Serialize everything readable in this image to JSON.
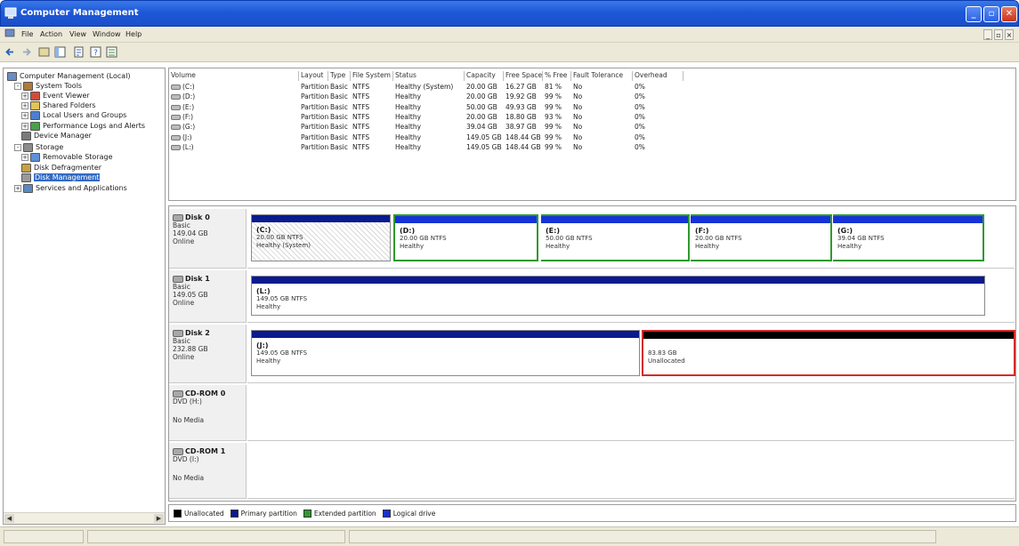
{
  "window": {
    "title": "Computer Management"
  },
  "menu": [
    "File",
    "Action",
    "View",
    "Window",
    "Help"
  ],
  "tree": [
    {
      "label": "Computer Management (Local)",
      "icon": "computer-icon",
      "indent": 0,
      "expander": ""
    },
    {
      "label": "System Tools",
      "icon": "tools-icon",
      "indent": 1,
      "expander": "-"
    },
    {
      "label": "Event Viewer",
      "icon": "event-viewer-icon",
      "indent": 2,
      "expander": "+"
    },
    {
      "label": "Shared Folders",
      "icon": "shared-folder-icon",
      "indent": 2,
      "expander": "+"
    },
    {
      "label": "Local Users and Groups",
      "icon": "users-icon",
      "indent": 2,
      "expander": "+"
    },
    {
      "label": "Performance Logs and Alerts",
      "icon": "performance-icon",
      "indent": 2,
      "expander": "+"
    },
    {
      "label": "Device Manager",
      "icon": "device-manager-icon",
      "indent": 2,
      "expander": ""
    },
    {
      "label": "Storage",
      "icon": "storage-icon",
      "indent": 1,
      "expander": "-"
    },
    {
      "label": "Removable Storage",
      "icon": "removable-storage-icon",
      "indent": 2,
      "expander": "+"
    },
    {
      "label": "Disk Defragmenter",
      "icon": "defrag-icon",
      "indent": 2,
      "expander": ""
    },
    {
      "label": "Disk Management",
      "icon": "disk-management-icon",
      "indent": 2,
      "expander": "",
      "selected": true
    },
    {
      "label": "Services and Applications",
      "icon": "services-icon",
      "indent": 1,
      "expander": "+"
    }
  ],
  "volume_columns": [
    "Volume",
    "Layout",
    "Type",
    "File System",
    "Status",
    "Capacity",
    "Free Space",
    "% Free",
    "Fault Tolerance",
    "Overhead"
  ],
  "volumes": [
    [
      "(C:)",
      "Partition",
      "Basic",
      "NTFS",
      "Healthy (System)",
      "20.00 GB",
      "16.27 GB",
      "81 %",
      "No",
      "0%"
    ],
    [
      "(D:)",
      "Partition",
      "Basic",
      "NTFS",
      "Healthy",
      "20.00 GB",
      "19.92 GB",
      "99 %",
      "No",
      "0%"
    ],
    [
      "(E:)",
      "Partition",
      "Basic",
      "NTFS",
      "Healthy",
      "50.00 GB",
      "49.93 GB",
      "99 %",
      "No",
      "0%"
    ],
    [
      "(F:)",
      "Partition",
      "Basic",
      "NTFS",
      "Healthy",
      "20.00 GB",
      "18.80 GB",
      "93 %",
      "No",
      "0%"
    ],
    [
      "(G:)",
      "Partition",
      "Basic",
      "NTFS",
      "Healthy",
      "39.04 GB",
      "38.97 GB",
      "99 %",
      "No",
      "0%"
    ],
    [
      "(J:)",
      "Partition",
      "Basic",
      "NTFS",
      "Healthy",
      "149.05 GB",
      "148.44 GB",
      "99 %",
      "No",
      "0%"
    ],
    [
      "(L:)",
      "Partition",
      "Basic",
      "NTFS",
      "Healthy",
      "149.05 GB",
      "148.44 GB",
      "99 %",
      "No",
      "0%"
    ]
  ],
  "disks": [
    {
      "name": "Disk 0",
      "type": "Basic",
      "size": "149.04 GB",
      "status": "Online",
      "partitions": [
        {
          "name": "(C:)",
          "size": "20.00 GB NTFS",
          "status": "Healthy (System)"
        },
        {
          "name": "(D:)",
          "size": "20.00 GB NTFS",
          "status": "Healthy"
        },
        {
          "name": "(E:)",
          "size": "50.00 GB NTFS",
          "status": "Healthy"
        },
        {
          "name": "(F:)",
          "size": "20.00 GB NTFS",
          "status": "Healthy"
        },
        {
          "name": "(G:)",
          "size": "39.04 GB NTFS",
          "status": "Healthy"
        }
      ]
    },
    {
      "name": "Disk 1",
      "type": "Basic",
      "size": "149.05 GB",
      "status": "Online",
      "partitions": [
        {
          "name": "(L:)",
          "size": "149.05 GB NTFS",
          "status": "Healthy"
        }
      ]
    },
    {
      "name": "Disk 2",
      "type": "Basic",
      "size": "232.88 GB",
      "status": "Online",
      "partitions": [
        {
          "name": "(J:)",
          "size": "149.05 GB NTFS",
          "status": "Healthy"
        },
        {
          "name": "",
          "size": "83.83 GB",
          "status": "Unallocated"
        }
      ]
    },
    {
      "name": "CD-ROM 0",
      "type": "DVD (H:)",
      "size": "",
      "status": "No Media",
      "partitions": []
    },
    {
      "name": "CD-ROM 1",
      "type": "DVD (I:)",
      "size": "",
      "status": "No Media",
      "partitions": []
    }
  ],
  "legend": [
    {
      "label": "Unallocated",
      "color": "#000000"
    },
    {
      "label": "Primary partition",
      "color": "#0a1a8f"
    },
    {
      "label": "Extended partition",
      "color": "#2e9a2e"
    },
    {
      "label": "Logical drive",
      "color": "#1533d6"
    }
  ],
  "colors": {
    "primary": "#0a1a8f",
    "extended": "#2e9a2e",
    "logical": "#1533d6",
    "unallocated": "#000000",
    "selection": "#d42a2a"
  }
}
